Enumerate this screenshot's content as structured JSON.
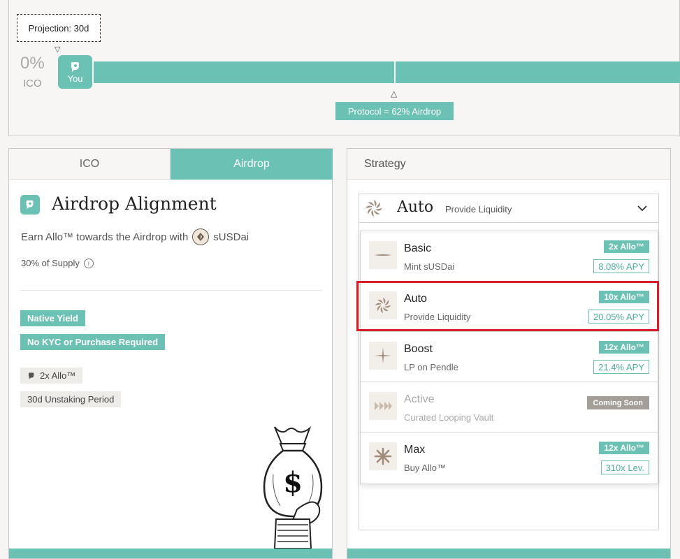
{
  "projection": {
    "label": "Projection: 30d",
    "ico_percent": "0%",
    "ico_label": "ICO",
    "you_label": "You",
    "protocol_label": "Protocol = 62% Airdrop"
  },
  "left_card": {
    "tabs": [
      {
        "label": "ICO",
        "active": false
      },
      {
        "label": "Airdrop",
        "active": true
      }
    ],
    "title": "Airdrop Alignment",
    "earn_text": "Earn Allo™ towards the Airdrop with",
    "token": "sUSDai",
    "supply_text": "30% of Supply",
    "tags_teal": [
      "Native Yield",
      "No KYC or Purchase Required"
    ],
    "tags_gray": [
      "2x Allo™",
      "30d Unstaking Period"
    ]
  },
  "strategy": {
    "header": "Strategy",
    "selected": {
      "name": "Auto",
      "subtitle": "Provide Liquidity"
    },
    "options": [
      {
        "name": "Basic",
        "subtitle": "Mint sUSDai",
        "multiplier": "2x Allo™",
        "apy": "8.08% APY",
        "icon": "dash-icon"
      },
      {
        "name": "Auto",
        "subtitle": "Provide Liquidity",
        "multiplier": "10x Allo™",
        "apy": "20.05% APY",
        "icon": "spiral-icon"
      },
      {
        "name": "Boost",
        "subtitle": "LP on Pendle",
        "multiplier": "12x Allo™",
        "apy": "21.4% APY",
        "icon": "sparkle-icon"
      },
      {
        "name": "Active",
        "subtitle": "Curated Looping Vault",
        "status": "Coming Soon",
        "icon": "chevrons-icon"
      },
      {
        "name": "Max",
        "subtitle": "Buy Allo™",
        "multiplier": "12x Allo™",
        "apy": "310x Lev.",
        "icon": "starburst-icon"
      }
    ]
  },
  "colors": {
    "accent": "#6cc1b5",
    "highlight": "#d81e28",
    "icon_brown": "#a08a78"
  }
}
